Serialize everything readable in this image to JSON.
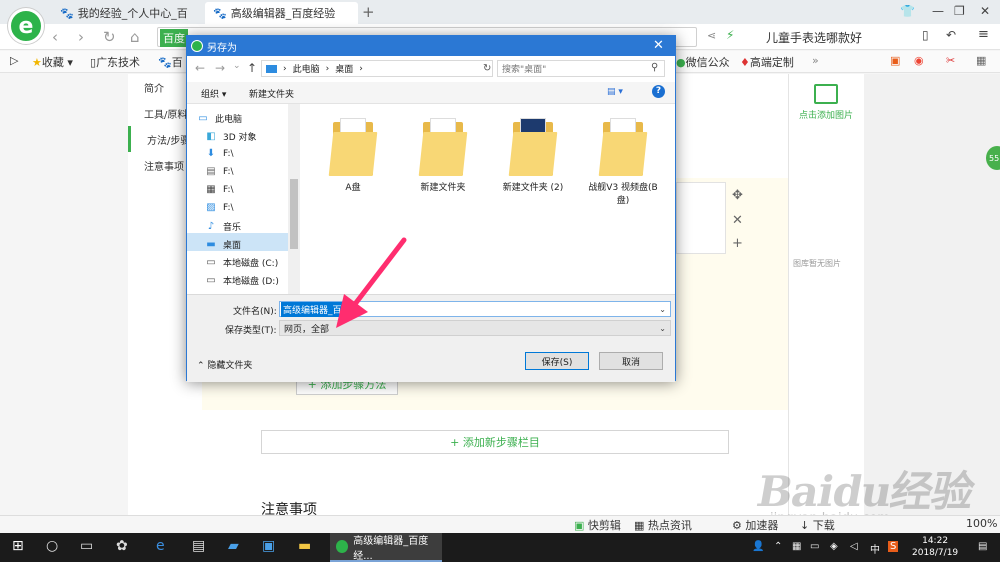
{
  "browser": {
    "tabs": [
      {
        "label": "我的经验_个人中心_百"
      },
      {
        "label": "高级编辑器_百度经验"
      }
    ],
    "address_tag": "百度",
    "search_hint": "儿童手表选哪款好",
    "bookmarks": [
      "收藏",
      "广东技术",
      "百",
      "微信公众",
      "高端定制"
    ]
  },
  "page": {
    "left_nav": [
      "简介",
      "工具/原料",
      "方法/步骤",
      "注意事项"
    ],
    "add_method": "+ 添加步骤方法",
    "add_section": "+ 添加新步骤栏目",
    "notes_title": "注意事项",
    "right_panel": {
      "add_image": "点击添加图片",
      "no_image": "图库暂无图片"
    },
    "badge": "55"
  },
  "statusbar": {
    "items": [
      "快剪辑",
      "热点资讯",
      "加速器",
      "下载",
      "100%"
    ],
    "watermark": "Baidu经验",
    "watermark_url": "jingyan.baidu.com"
  },
  "dialog": {
    "title": "另存为",
    "path": [
      "此电脑",
      "桌面"
    ],
    "search_placeholder": "搜索\"桌面\"",
    "toolbar": {
      "organize": "组织 ▾",
      "new_folder": "新建文件夹"
    },
    "tree": [
      {
        "label": "此电脑",
        "icon": "computer-icon"
      },
      {
        "label": "3D 对象",
        "icon": "cube-icon"
      },
      {
        "label": "F:\\",
        "icon": "download-icon"
      },
      {
        "label": "F:\\",
        "icon": "document-icon"
      },
      {
        "label": "F:\\",
        "icon": "video-icon"
      },
      {
        "label": "F:\\",
        "icon": "picture-icon"
      },
      {
        "label": "音乐",
        "icon": "music-icon"
      },
      {
        "label": "桌面",
        "icon": "desktop-icon"
      },
      {
        "label": "本地磁盘 (C:)",
        "icon": "drive-icon"
      },
      {
        "label": "本地磁盘 (D:)",
        "icon": "drive-icon"
      }
    ],
    "files": [
      {
        "name": "A盘"
      },
      {
        "name": "新建文件夹"
      },
      {
        "name": "新建文件夹 (2)"
      },
      {
        "name": "战舰V3 视频盘(B盘)"
      }
    ],
    "filename_label": "文件名(N):",
    "filename_value": "高级编辑器_百度",
    "filetype_label": "保存类型(T):",
    "filetype_value": "网页，全部",
    "hide_folders": "隐藏文件夹",
    "save": "保存(S)",
    "cancel": "取消"
  },
  "taskbar": {
    "active_task": "高级编辑器_百度经...",
    "tray_lang": "中",
    "time": "14:22",
    "date": "2018/7/19"
  },
  "colors": {
    "accent_green": "#3cb04f",
    "dialog_blue": "#2b78d4",
    "arrow_pink": "#ff2d6f"
  }
}
